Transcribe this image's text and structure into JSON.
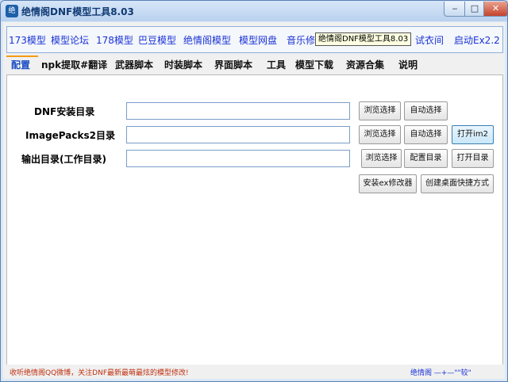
{
  "window": {
    "title": "绝情阁DNF模型工具8.03",
    "icon": "app-icon",
    "icon_glyph": "绝",
    "controls": {
      "minimize": "‒",
      "maximize": "□",
      "close": "✕"
    }
  },
  "links": [
    "173模型",
    "模型论坛",
    "178模型",
    "巴豆模型",
    "绝情阁模型",
    "模型网盘",
    "音乐修",
    "还原",
    "试衣间",
    "启动Ex2.2"
  ],
  "tooltip": "绝情阁DNF模型工具8.03",
  "tabs": [
    "配置",
    "npk提取#翻译",
    "武器脚本",
    "时装脚本",
    "界面脚本",
    "工具",
    "模型下载",
    "资源合集",
    "说明"
  ],
  "config": {
    "dnf_dir": {
      "label": "DNF安装目录",
      "value": "",
      "browse": "浏览选择",
      "auto": "自动选择"
    },
    "imagepacks": {
      "label": "ImagePacks2目录",
      "value": "",
      "browse": "浏览选择",
      "auto": "自动选择",
      "open": "打开im2"
    },
    "output": {
      "label": "输出目录(工作目录)",
      "value": "",
      "browse": "浏览选择",
      "config": "配置目录",
      "open": "打开目录"
    },
    "install_ex": "安装ex修改器",
    "shortcut": "创建桌面快捷方式"
  },
  "status": {
    "left": "收听绝情阁QQ微博，关注DNF最新最萌最炫的模型修改!",
    "right": "绝情阁 —+—\"\"较\""
  },
  "colors": {
    "link": "#1b33d6",
    "active_tab": "#1b4fc4",
    "tab_underline": "#f39c12",
    "status_left": "#c03010"
  }
}
